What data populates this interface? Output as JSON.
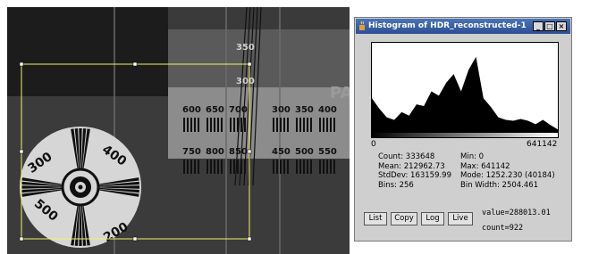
{
  "image_window": {
    "chart_labels": [
      "350",
      "300",
      "PA",
      "300",
      "400",
      "500",
      "200"
    ],
    "bar_labels_row1": [
      "600",
      "650",
      "700",
      "300",
      "350",
      "400"
    ],
    "bar_labels_row2": [
      "750",
      "800",
      "850",
      "450",
      "500",
      "550"
    ]
  },
  "histogram_window": {
    "title": "Histogram of HDR_reconstructed-1",
    "buttons": {
      "minimize": "_",
      "maximize": "□",
      "close": "×"
    },
    "axis_min": "0",
    "axis_max": "641142",
    "stats_left": [
      "Count: 333648",
      "Mean: 212962.73",
      "StdDev: 163159.99",
      "Bins: 256"
    ],
    "stats_right": [
      "Min: 0",
      "Max: 641142",
      "Mode: 1252.230 (40184)",
      "Bin Width: 2504.461"
    ],
    "action_buttons": {
      "list": "List",
      "copy": "Copy",
      "log": "Log",
      "live": "Live"
    },
    "value_readout": "value=288013.01",
    "count_readout": "count=922"
  },
  "chart_data": {
    "type": "area",
    "x_range": [
      0,
      641142
    ],
    "x_samples": [
      0,
      25646,
      51291,
      76937,
      102582,
      128228,
      153873,
      179519,
      205164,
      230810,
      256455,
      282101,
      307746,
      333392,
      359037,
      384683,
      410328,
      435974,
      461619,
      487265,
      512910,
      538556,
      564201,
      589847,
      615492,
      641142
    ],
    "relative_counts": [
      0.42,
      0.3,
      0.2,
      0.17,
      0.26,
      0.22,
      0.35,
      0.33,
      0.5,
      0.45,
      0.6,
      0.7,
      0.5,
      0.75,
      0.9,
      0.42,
      0.32,
      0.2,
      0.17,
      0.16,
      0.18,
      0.16,
      0.12,
      0.17,
      0.11,
      0.06
    ]
  },
  "colors": {
    "titlebar": "#3a60a8",
    "roi": "#f2f26a",
    "histogram_fill": "#000000"
  }
}
